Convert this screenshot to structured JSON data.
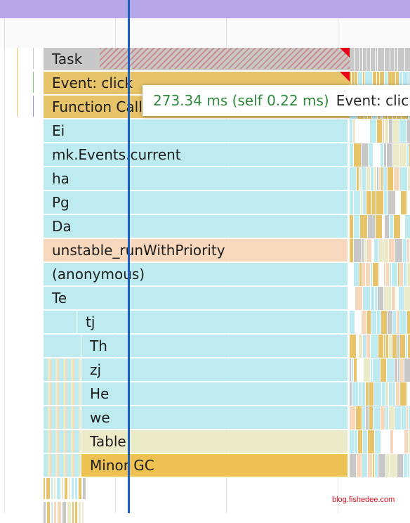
{
  "flame": {
    "rows": [
      {
        "label": "Task",
        "type": "task"
      },
      {
        "label": "Event: click",
        "type": "event"
      },
      {
        "label": "Function Call",
        "type": "event"
      },
      {
        "label": "Ei",
        "type": "script"
      },
      {
        "label": "mk.Events.current",
        "type": "script"
      },
      {
        "label": "ha",
        "type": "script"
      },
      {
        "label": "Pg",
        "type": "script"
      },
      {
        "label": "Da",
        "type": "script"
      },
      {
        "label": "unstable_runWithPriority",
        "type": "peach"
      },
      {
        "label": "(anonymous)",
        "type": "script"
      },
      {
        "label": "Te",
        "type": "script"
      },
      {
        "label": "tj",
        "type": "script"
      },
      {
        "label": "Th",
        "type": "script"
      },
      {
        "label": "zj",
        "type": "script"
      },
      {
        "label": "He",
        "type": "script"
      },
      {
        "label": "we",
        "type": "script"
      },
      {
        "label": "Table",
        "type": "tan"
      },
      {
        "label": "Minor GC",
        "type": "gc"
      }
    ]
  },
  "tooltip": {
    "time": "273.34 ms (self 0.22 ms)",
    "name": "Event: click"
  },
  "colors": {
    "task": "#c8c8c8",
    "event": "#e7c36a",
    "script": "#bdebf0",
    "peach": "#f8d8bd",
    "tan": "#ecebc9",
    "gc": "#eec153",
    "cursor": "#1a5fc4",
    "tooltip_time": "#2e8a3c",
    "timeline_header": "#b7a6e8"
  },
  "watermark": "blog.fishedee.com"
}
